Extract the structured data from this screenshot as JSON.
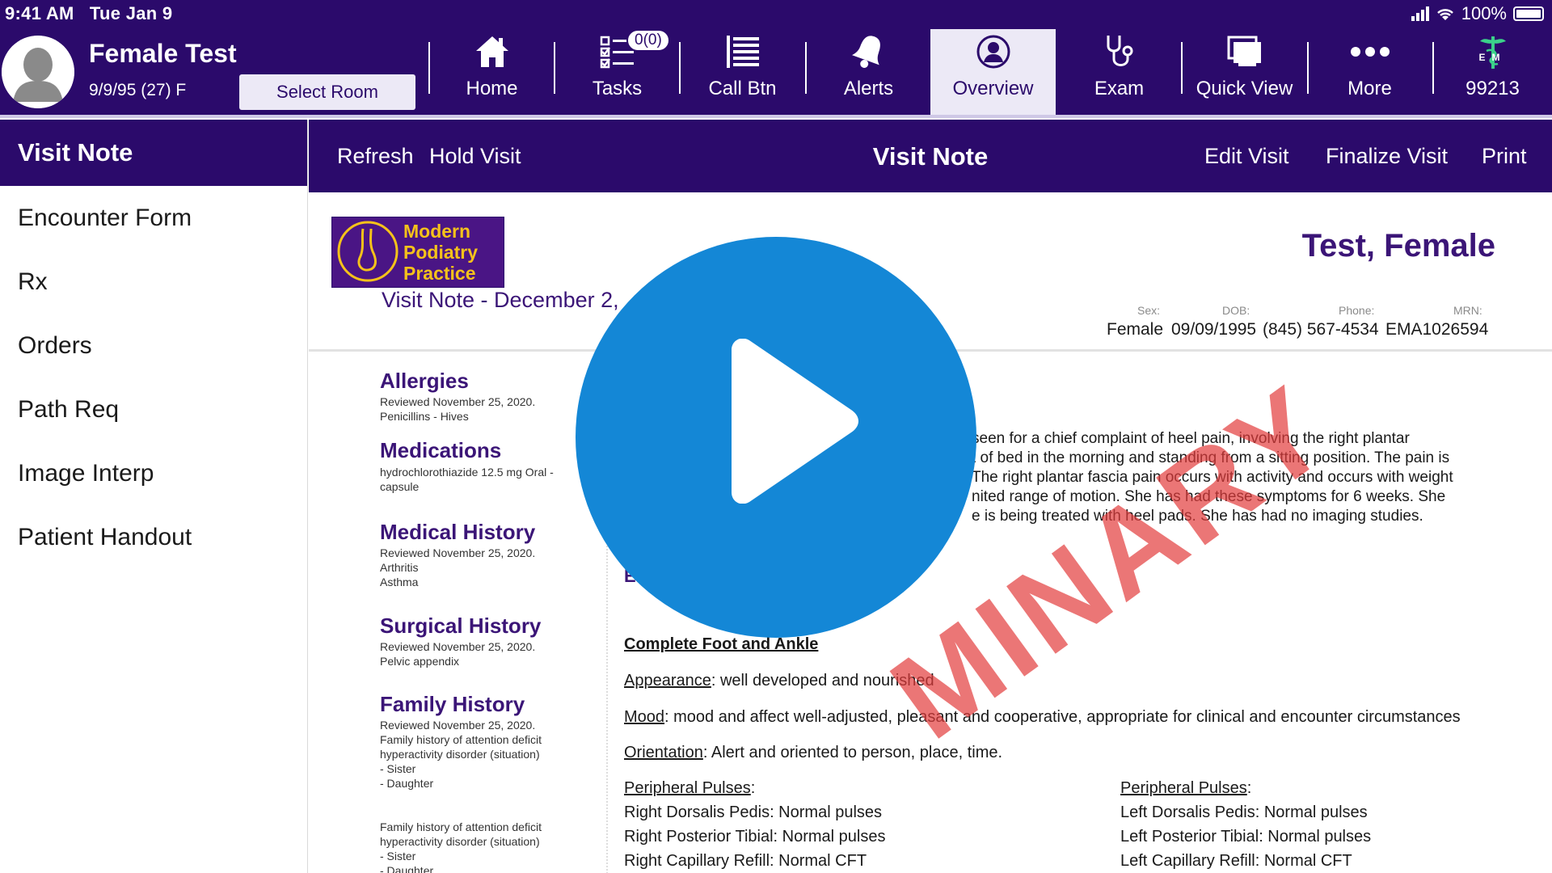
{
  "status": {
    "time": "9:41 AM",
    "date": "Tue Jan 9",
    "battery": "100%"
  },
  "patient": {
    "name": "Female Test",
    "dob_line": "9/9/95 (27) F"
  },
  "topbar": {
    "select_room": "Select Room",
    "tasks_badge": "0(0)",
    "nav": [
      {
        "label": "Home",
        "icon": "home-icon"
      },
      {
        "label": "Tasks",
        "icon": "checklist-icon"
      },
      {
        "label": "Call Btn",
        "icon": "list-icon"
      },
      {
        "label": "Alerts",
        "icon": "bell-icon"
      },
      {
        "label": "Overview",
        "icon": "person-icon",
        "active": true
      },
      {
        "label": "Exam",
        "icon": "stethoscope-icon"
      },
      {
        "label": "Quick View",
        "icon": "monitor-icon"
      },
      {
        "label": "More",
        "icon": "more-icon"
      },
      {
        "label": "99213",
        "icon": "em-caduceus-icon"
      }
    ],
    "em_icon_text": "EM"
  },
  "sidebar": {
    "header": "Visit Note",
    "items": [
      "Encounter Form",
      "Rx",
      "Orders",
      "Path Req",
      "Image Interp",
      "Patient Handout"
    ]
  },
  "toolbar": {
    "refresh": "Refresh",
    "hold": "Hold Visit",
    "title": "Visit Note",
    "edit": "Edit Visit",
    "finalize": "Finalize Visit",
    "print": "Print"
  },
  "doc": {
    "logo_lines": [
      "Modern",
      "Podiatry",
      "Practice"
    ],
    "visit_date": "Visit Note - December 2,",
    "patient_title": "Test, Female",
    "header_labels": {
      "sex": "Sex:",
      "dob": "DOB:",
      "phone": "Phone:",
      "mrn": "MRN:"
    },
    "header_values": {
      "sex": "Female",
      "dob": "09/09/1995",
      "phone": "(845) 567-4534",
      "mrn": "EMA1026594"
    },
    "left": {
      "allergies": {
        "title": "Allergies",
        "lines": [
          "Reviewed November 25, 2020.",
          "Penicillins - Hives"
        ]
      },
      "medications": {
        "title": "Medications",
        "lines": [
          "hydrochlorothiazide 12.5 mg Oral -",
          "capsule"
        ]
      },
      "medical_history": {
        "title": "Medical History",
        "lines": [
          "Reviewed November 25, 2020.",
          "Arthritis",
          "Asthma"
        ]
      },
      "surgical_history": {
        "title": "Surgical History",
        "lines": [
          "Reviewed November 25, 2020.",
          "Pelvic appendix"
        ]
      },
      "family_history": {
        "title": "Family History",
        "lines": [
          "Reviewed November 25, 2020.",
          "Family history of attention deficit",
          "hyperactivity disorder (situation)",
          "- Sister",
          "- Daughter"
        ]
      },
      "family_history_2": {
        "lines": [
          "Family history of attention deficit",
          "hyperactivity disorder (situation)",
          "- Sister",
          "- Daughter"
        ]
      }
    },
    "hpi_lines": [
      "seen for a chief complaint of heel pain, involving the right plantar",
      "t of bed in the morning and standing from a sitting position. The pain is",
      "The right plantar fascia pain occurs with activity and occurs with weight",
      "nited range of motion. She has had these symptoms for 6 weeks. She",
      "e is being treated with heel pads. She has had no imaging studies."
    ],
    "exam_heading": "E",
    "complete_foot": "Complete Foot and Ankle",
    "appearance": {
      "label": "Appearance",
      "text": ": well developed and nourished"
    },
    "mood": {
      "label": "Mood",
      "text": ": mood and affect well-adjusted, pleasant and cooperative, appropriate for clinical and encounter circumstances"
    },
    "orientation": {
      "label": "Orientation",
      "text": ": Alert and oriented to person, place, time."
    },
    "pulses_right": {
      "label": "Peripheral Pulses",
      "suffix": ":",
      "lines": [
        "Right Dorsalis Pedis: Normal pulses",
        "Right Posterior Tibial: Normal pulses",
        "Right Capillary Refill: Normal CFT"
      ]
    },
    "pulses_left": {
      "label": "Peripheral Pulses",
      "suffix": ":",
      "lines": [
        "Left Dorsalis Pedis: Normal pulses",
        "Left Posterior Tibial: Normal pulses",
        "Left Capillary Refill: Normal CFT"
      ]
    },
    "watermark": "MINARY"
  },
  "colors": {
    "brand_purple": "#2b0a6b",
    "play_blue": "#1487d6",
    "watermark_red": "#e23c3c",
    "logo_gold": "#f5c21a"
  }
}
